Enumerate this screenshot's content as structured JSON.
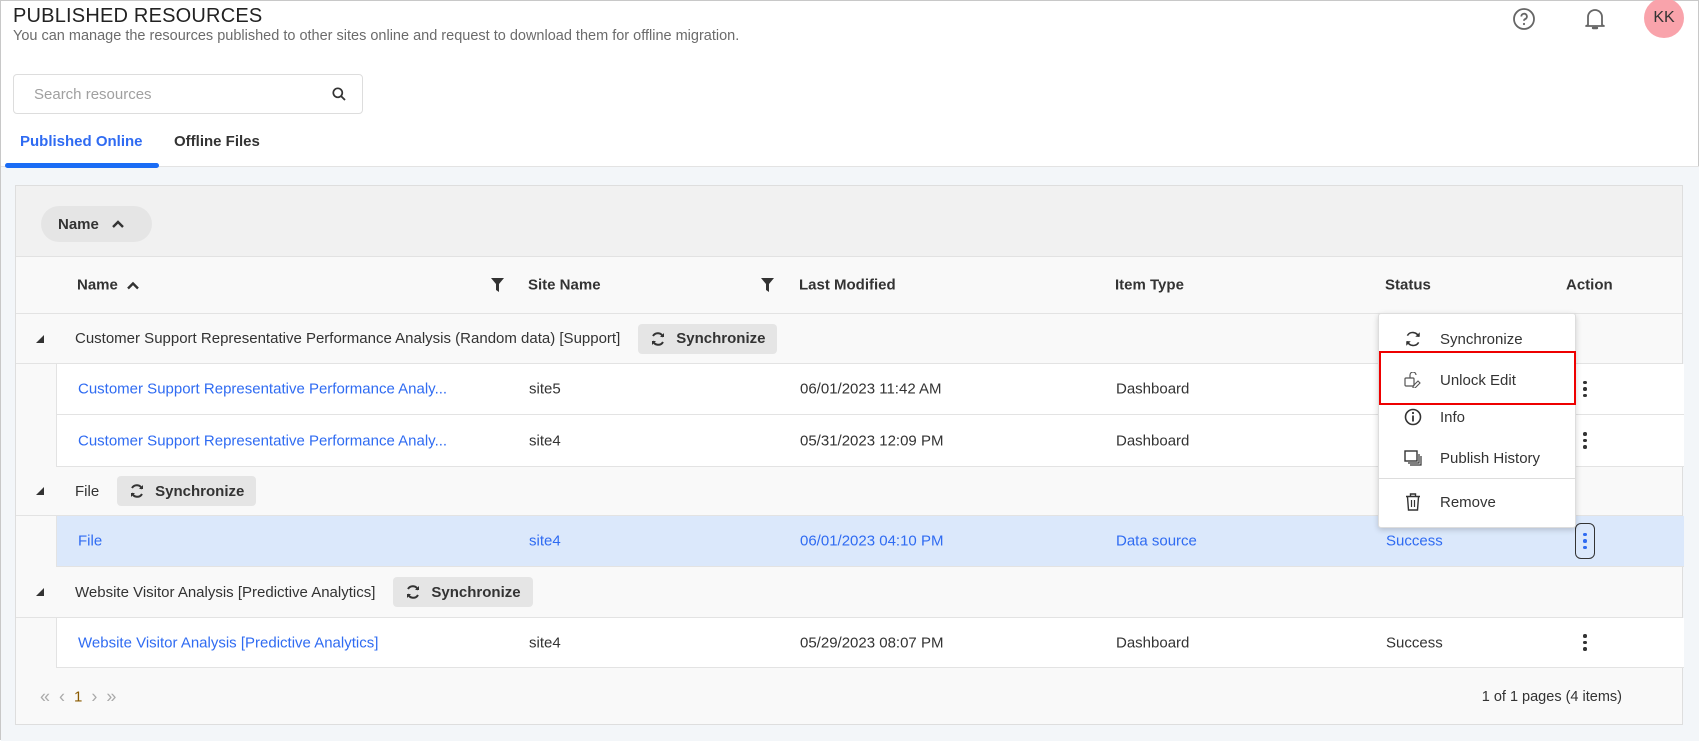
{
  "header": {
    "title": "PUBLISHED RESOURCES",
    "subtitle": "You can manage the resources published to other sites online and request to download them for offline migration.",
    "avatar_initials": "KK",
    "avatar_color": "#f9a3ab"
  },
  "search": {
    "placeholder": "Search resources",
    "value": ""
  },
  "tabs": [
    {
      "label": "Published Online",
      "active": true
    },
    {
      "label": "Offline Files",
      "active": false
    }
  ],
  "group_by": {
    "chip_label": "Name"
  },
  "columns": {
    "name": "Name",
    "site": "Site Name",
    "modified": "Last Modified",
    "type": "Item Type",
    "status": "Status",
    "action": "Action"
  },
  "groups": [
    {
      "title": "Customer Support Representative Performance Analysis (Random data) [Support]",
      "sync_label": "Synchronize",
      "rows": [
        {
          "name": "Customer Support Representative Performance Analy...",
          "site": "site5",
          "modified": "06/01/2023 11:42 AM",
          "type": "Dashboard",
          "status": ""
        },
        {
          "name": "Customer Support Representative Performance Analy...",
          "site": "site4",
          "modified": "05/31/2023 12:09 PM",
          "type": "Dashboard",
          "status": ""
        }
      ]
    },
    {
      "title": "File",
      "sync_label": "Synchronize",
      "rows": [
        {
          "name": "File",
          "site": "site4",
          "modified": "06/01/2023 04:10 PM",
          "type": "Data source",
          "status": "Success",
          "selected": true
        }
      ]
    },
    {
      "title": "Website Visitor Analysis [Predictive Analytics]",
      "sync_label": "Synchronize",
      "rows": [
        {
          "name": "Website Visitor Analysis [Predictive Analytics]",
          "site": "site4",
          "modified": "05/29/2023 08:07 PM",
          "type": "Dashboard",
          "status": "Success"
        }
      ]
    }
  ],
  "context_menu": {
    "items": [
      {
        "label": "Synchronize",
        "icon": "sync-icon"
      },
      {
        "label": "Unlock Edit",
        "icon": "unlock-edit-icon",
        "highlighted": true
      },
      {
        "label": "Info",
        "icon": "info-icon"
      },
      {
        "label": "Publish History",
        "icon": "history-icon"
      },
      {
        "label": "Remove",
        "icon": "trash-icon"
      }
    ]
  },
  "pagination": {
    "current_page": "1",
    "summary": "1 of 1 pages (4 items)"
  },
  "colors": {
    "accent": "#2f6bf2",
    "selected_row": "#dbe8fb",
    "highlight_box": "#ee0000"
  }
}
